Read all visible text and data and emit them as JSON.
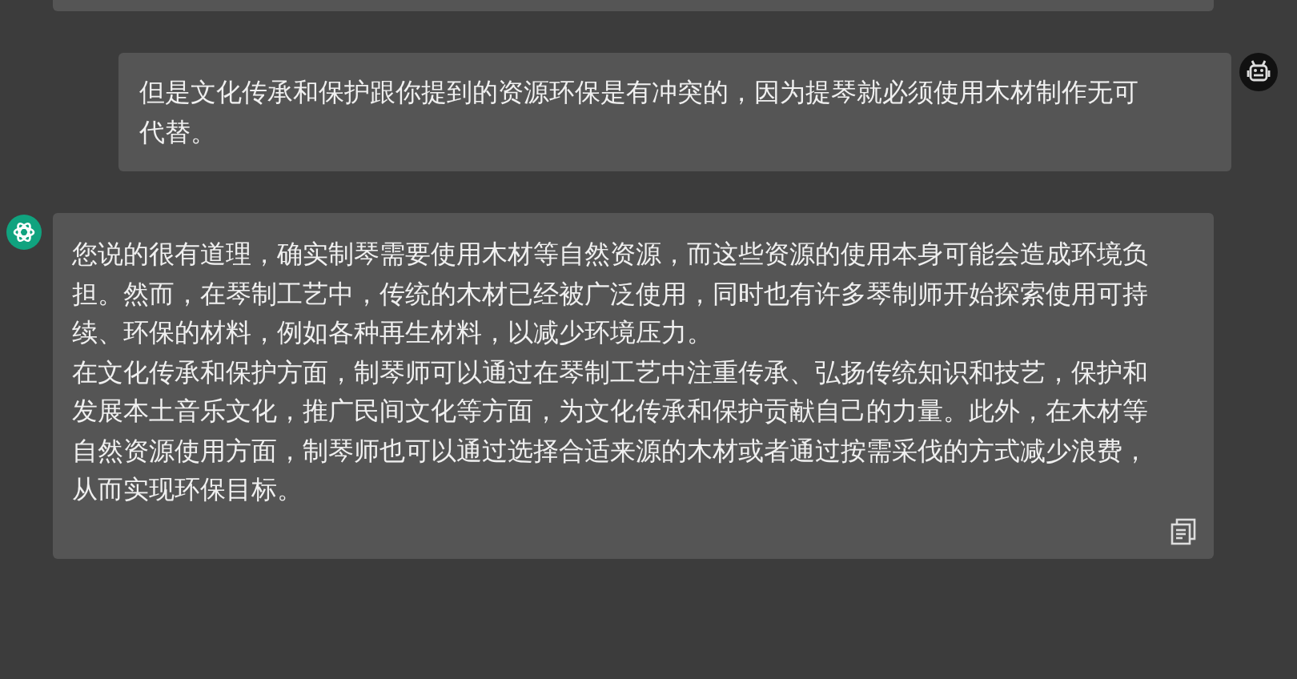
{
  "messages": [
    {
      "kind": "user",
      "paragraphs": [
        "但是文化传承和保护跟你提到的资源环保是有冲突的，因为提琴就必须使用木材制作无可代替。"
      ]
    },
    {
      "kind": "assistant",
      "paragraphs": [
        "您说的很有道理，确实制琴需要使用木材等自然资源，而这些资源的使用本身可能会造成环境负担。然而，在琴制工艺中，传统的木材已经被广泛使用，同时也有许多琴制师开始探索使用可持续、环保的材料，例如各种再生材料，以减少环境压力。",
        "在文化传承和保护方面，制琴师可以通过在琴制工艺中注重传承、弘扬传统知识和技艺，保护和发展本土音乐文化，推广民间文化等方面，为文化传承和保护贡献自己的力量。此外，在木材等自然资源使用方面，制琴师也可以通过选择合适来源的木材或者通过按需采伐的方式减少浪费，从而实现环保目标。"
      ]
    }
  ]
}
